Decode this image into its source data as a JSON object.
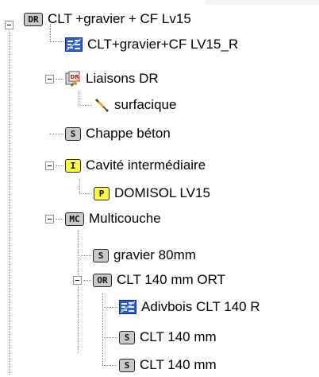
{
  "tree": {
    "root": {
      "label": "CLT +gravier + CF Lv15",
      "badge": "DR"
    },
    "material_1": {
      "label": "CLT+gravier+CF LV15_R",
      "icon": "material-swatch-icon"
    },
    "liaisons": {
      "label": "Liaisons DR",
      "icon": "liaisons-dr-icon"
    },
    "surfacique": {
      "label": "surfacique",
      "icon": "surface-link-icon"
    },
    "chappe": {
      "label": "Chappe béton",
      "badge": "S"
    },
    "cavite": {
      "label": "Cavité intermédiaire",
      "badge": "I"
    },
    "domisol": {
      "label": "DOMISOL LV15",
      "badge": "P"
    },
    "multicouche": {
      "label": "Multicouche",
      "badge": "MC"
    },
    "gravier": {
      "label": "gravier 80mm",
      "badge": "S"
    },
    "clt_ort": {
      "label": "CLT 140 mm ORT",
      "badge": "OR"
    },
    "adivbois": {
      "label": "Adivbois CLT 140 R",
      "icon": "material-swatch-icon"
    },
    "clt_1": {
      "label": "CLT 140 mm",
      "badge": "S"
    },
    "clt_2": {
      "label": "CLT 140 mm",
      "badge": "S"
    }
  },
  "colors": {
    "badge_grey": "#c9c9c9",
    "badge_yellow": "#ffff33",
    "connector": "#8a8a8a"
  }
}
